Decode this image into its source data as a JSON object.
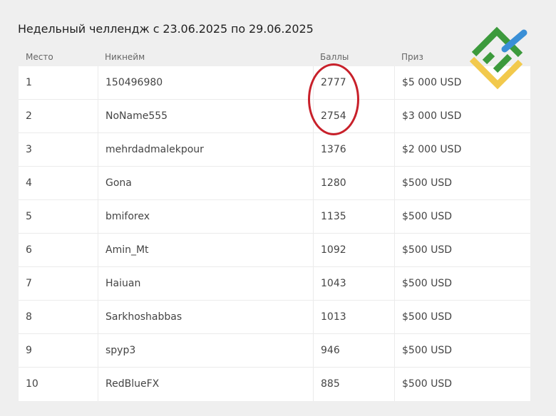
{
  "title": "Недельный челлендж с 23.06.2025 по 29.06.2025",
  "columns": {
    "place": "Место",
    "nickname": "Никнейм",
    "points": "Баллы",
    "prize": "Приз"
  },
  "rows": [
    {
      "place": "1",
      "nickname": "150496980",
      "points": "2777",
      "prize": "$5 000 USD"
    },
    {
      "place": "2",
      "nickname": "NoName555",
      "points": "2754",
      "prize": "$3 000 USD"
    },
    {
      "place": "3",
      "nickname": "mehrdadmalekpour",
      "points": "1376",
      "prize": "$2 000 USD"
    },
    {
      "place": "4",
      "nickname": "Gona",
      "points": "1280",
      "prize": "$500 USD"
    },
    {
      "place": "5",
      "nickname": "bmiforex",
      "points": "1135",
      "prize": "$500 USD"
    },
    {
      "place": "6",
      "nickname": "Amin_Mt",
      "points": "1092",
      "prize": "$500 USD"
    },
    {
      "place": "7",
      "nickname": "Haiuan",
      "points": "1043",
      "prize": "$500 USD"
    },
    {
      "place": "8",
      "nickname": "Sarkhoshabbas",
      "points": "1013",
      "prize": "$500 USD"
    },
    {
      "place": "9",
      "nickname": "spyp3",
      "points": "946",
      "prize": "$500 USD"
    },
    {
      "place": "10",
      "nickname": "RedBlueFX",
      "points": "885",
      "prize": "$500 USD"
    }
  ],
  "logo": {
    "icon": "brand-logo-icon",
    "colors": [
      "#3c9a3c",
      "#f2c94c",
      "#3a8fd6"
    ]
  },
  "highlight": {
    "color": "#c8202a",
    "rows": [
      "1",
      "2"
    ]
  }
}
